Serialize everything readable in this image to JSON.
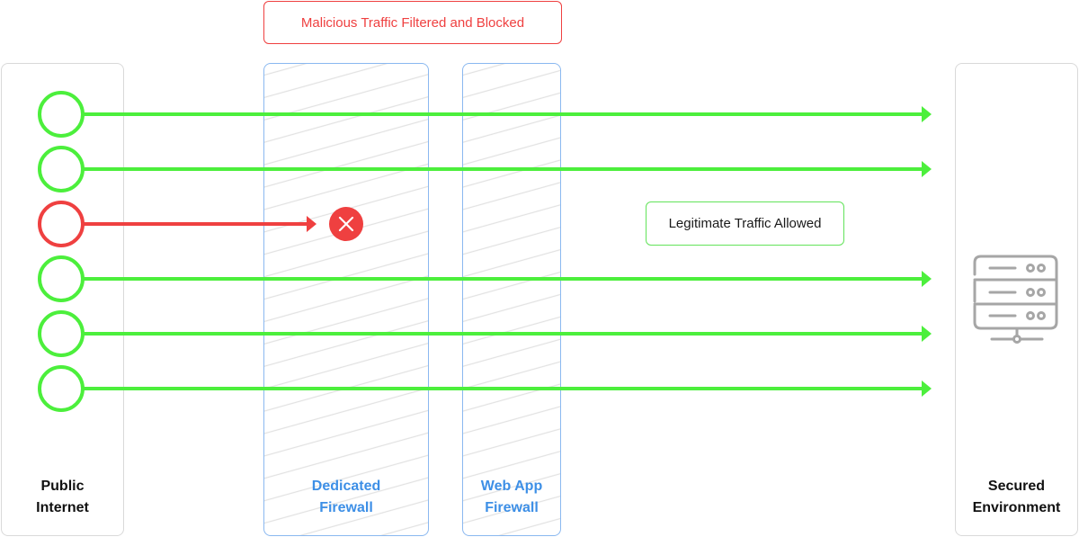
{
  "diagram": {
    "title_callout": "Malicious Traffic Filtered and Blocked",
    "allowed_callout": "Legitimate Traffic Allowed",
    "zones": [
      {
        "id": "public-internet",
        "label_lines": [
          "Public",
          "Internet"
        ],
        "style": "plain"
      },
      {
        "id": "dedicated-firewall",
        "label_lines": [
          "Dedicated",
          "Firewall"
        ],
        "style": "firewall"
      },
      {
        "id": "web-app-firewall",
        "label_lines": [
          "Web App",
          "Firewall"
        ],
        "style": "firewall"
      },
      {
        "id": "secured-environment",
        "label_lines": [
          "Secured",
          "Environment"
        ],
        "style": "plain",
        "icon": "server-icon"
      }
    ],
    "flows": [
      {
        "status": "allowed",
        "reaches": "secured-environment"
      },
      {
        "status": "allowed",
        "reaches": "secured-environment"
      },
      {
        "status": "blocked",
        "reaches": "dedicated-firewall",
        "end_icon": "blocked-x-icon"
      },
      {
        "status": "allowed",
        "reaches": "secured-environment"
      },
      {
        "status": "allowed",
        "reaches": "secured-environment"
      },
      {
        "status": "allowed",
        "reaches": "secured-environment"
      }
    ],
    "colors": {
      "allowed": "#4cef3c",
      "blocked": "#ef4040",
      "firewall_border": "#8ab8f0",
      "firewall_label": "#3d8fe6",
      "zone_border": "#d9d9d9",
      "hatch": "#e2e2e2",
      "icon_gray": "#a6a6a6"
    }
  }
}
